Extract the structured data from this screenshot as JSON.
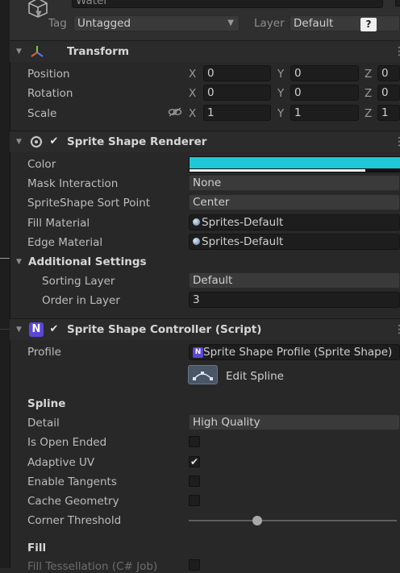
{
  "object": {
    "name": "Water",
    "tag_label": "Tag",
    "tag_value": "Untagged",
    "layer_label": "Layer",
    "layer_value": "Default"
  },
  "transform": {
    "title": "Transform",
    "position": {
      "label": "Position",
      "x": "0",
      "y": "0",
      "z": "0"
    },
    "rotation": {
      "label": "Rotation",
      "x": "0",
      "y": "0",
      "z": "0"
    },
    "scale": {
      "label": "Scale",
      "x": "1",
      "y": "1",
      "z": "1"
    },
    "axis": {
      "x": "X",
      "y": "Y",
      "z": "Z"
    }
  },
  "renderer": {
    "title": "Sprite Shape Renderer",
    "color_label": "Color",
    "color_value": "#1ec8d6",
    "mask_label": "Mask Interaction",
    "mask_value": "None",
    "sort_label": "SpriteShape Sort Point",
    "sort_value": "Center",
    "fill_label": "Fill Material",
    "fill_value": "Sprites-Default",
    "edge_label": "Edge Material",
    "edge_value": "Sprites-Default",
    "additional_label": "Additional Settings",
    "sorting_layer_label": "Sorting Layer",
    "sorting_layer_value": "Default",
    "order_label": "Order in Layer",
    "order_value": "3"
  },
  "controller": {
    "title": "Sprite Shape Controller (Script)",
    "profile_label": "Profile",
    "profile_value": "Sprite Shape Profile (Sprite Shape)",
    "edit_spline_label": "Edit Spline",
    "spline_header": "Spline",
    "detail_label": "Detail",
    "detail_value": "High Quality",
    "open_ended_label": "Is Open Ended",
    "open_ended": false,
    "adaptive_label": "Adaptive UV",
    "adaptive": true,
    "tangents_label": "Enable Tangents",
    "tangents": false,
    "cache_label": "Cache Geometry",
    "cache": false,
    "corner_label": "Corner Threshold",
    "corner_fraction": 0.33,
    "fill_header": "Fill"
  }
}
